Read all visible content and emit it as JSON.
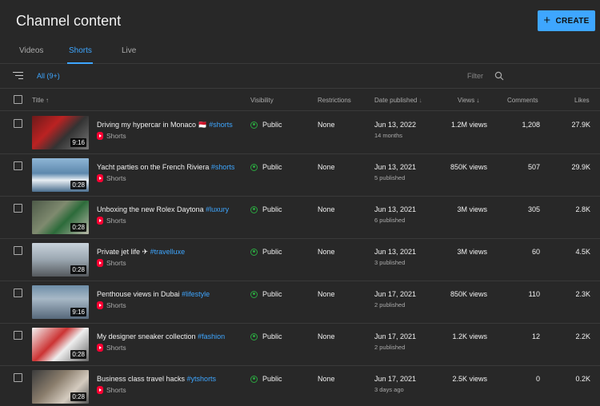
{
  "header": {
    "title": "Channel content",
    "create_label": "CREATE"
  },
  "tabs": [
    {
      "label": "Videos"
    },
    {
      "label": "Shorts"
    },
    {
      "label": "Live"
    }
  ],
  "filterbar": {
    "chip": "All (9+)",
    "filter_label": "Filter"
  },
  "columns": {
    "title": "Title",
    "visibility": "Visibility",
    "restrictions": "Restrictions",
    "date": "Date published",
    "views": "Views",
    "comments": "Comments",
    "likes": "Likes"
  },
  "rows": [
    {
      "duration": "9:16",
      "title": "Driving my hypercar in Monaco 🇲🇨 ",
      "tag": "#shorts",
      "type": "Shorts",
      "visibility": "Public",
      "restrictions": "None",
      "date": "Jun 13, 2022",
      "date_sub": "14 months",
      "views": "1.2M views",
      "comments": "1,208",
      "likes": "27.9K"
    },
    {
      "duration": "0:28",
      "title": "Yacht parties on the French Riviera ",
      "tag": "#shorts",
      "type": "Shorts",
      "visibility": "Public",
      "restrictions": "None",
      "date": "Jun 13, 2021",
      "date_sub": "5 published",
      "views": "850K views",
      "comments": "507",
      "likes": "29.9K"
    },
    {
      "duration": "0:28",
      "title": "Unboxing the new Rolex Daytona ",
      "tag": "#luxury",
      "type": "Shorts",
      "visibility": "Public",
      "restrictions": "None",
      "date": "Jun 13, 2021",
      "date_sub": "6 published",
      "views": "3M views",
      "comments": "305",
      "likes": "2.8K"
    },
    {
      "duration": "0:28",
      "title": "Private jet life ✈ ",
      "tag": "#travelluxe",
      "type": "Shorts",
      "visibility": "Public",
      "restrictions": "None",
      "date": "Jun 13, 2021",
      "date_sub": "3 published",
      "views": "3M views",
      "comments": "60",
      "likes": "4.5K"
    },
    {
      "duration": "9:16",
      "title": "Penthouse views in Dubai ",
      "tag": "#lifestyle",
      "type": "Shorts",
      "visibility": "Public",
      "restrictions": "None",
      "date": "Jun 17, 2021",
      "date_sub": "2 published",
      "views": "850K views",
      "comments": "110",
      "likes": "2.3K"
    },
    {
      "duration": "0:28",
      "title": "My designer sneaker collection ",
      "tag": "#fashion",
      "type": "Shorts",
      "visibility": "Public",
      "restrictions": "None",
      "date": "Jun 17, 2021",
      "date_sub": "2 published",
      "views": "1.2K views",
      "comments": "12",
      "likes": "2.2K"
    },
    {
      "duration": "0:28",
      "title": "Business class travel hacks ",
      "tag": "#ytshorts",
      "type": "Shorts",
      "visibility": "Public",
      "restrictions": "None",
      "date": "Jun 17, 2021",
      "date_sub": "3 days ago",
      "views": "2.5K views",
      "comments": "0",
      "likes": "0.2K"
    }
  ],
  "colors": {
    "accent": "#3ea6ff",
    "public_green": "#2ba640",
    "shorts_red": "#ff0033",
    "background": "#282828"
  }
}
